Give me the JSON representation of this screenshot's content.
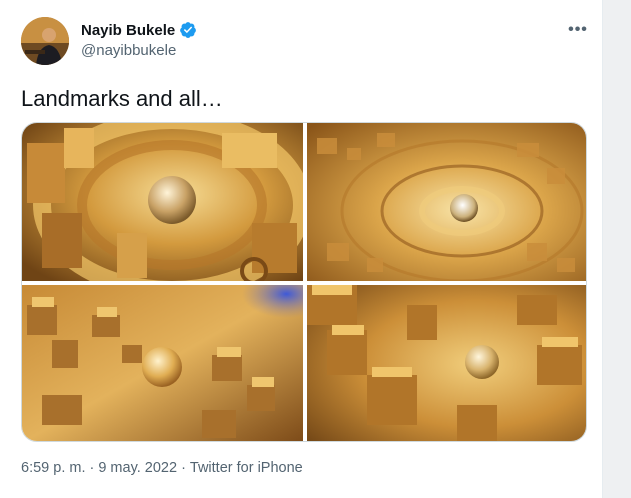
{
  "author": {
    "name": "Nayib Bukele",
    "handle": "@nayibbukele",
    "verified_icon": "verified-badge-icon"
  },
  "tweet": {
    "text": "Landmarks and all…",
    "images": [
      {
        "alt": "",
        "label": "photo-1"
      },
      {
        "alt": "",
        "label": "photo-2"
      },
      {
        "alt": "",
        "label": "photo-3"
      },
      {
        "alt": "",
        "label": "photo-4"
      }
    ],
    "time": "6:59 p. m.",
    "separator": "·",
    "date": "9 may. 2022",
    "source": "Twitter for iPhone"
  },
  "colors": {
    "verified": "#1d9bf0",
    "text_primary": "#0f1419",
    "text_secondary": "#536471",
    "gold_light": "#f3cf7a",
    "gold_mid": "#d49a3a",
    "gold_dark": "#7a4a16"
  }
}
